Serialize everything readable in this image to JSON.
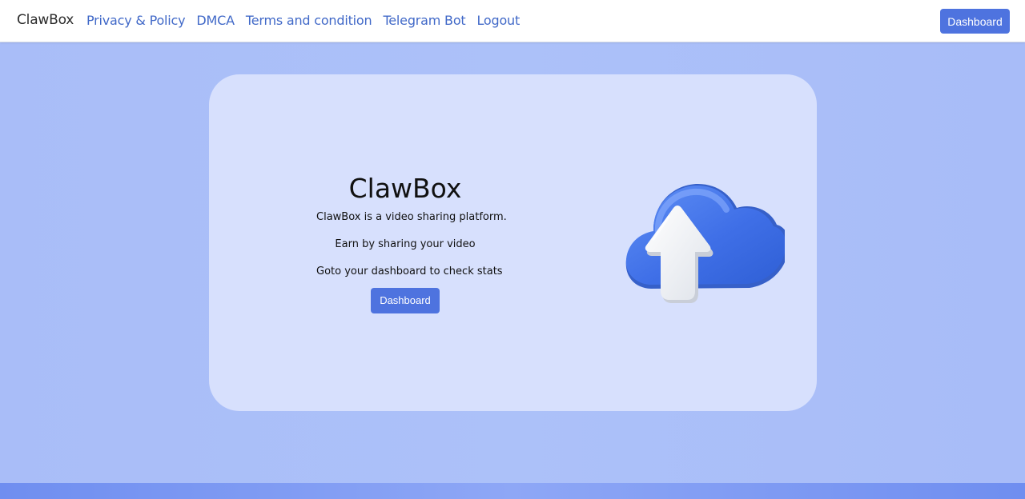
{
  "nav": {
    "brand": "ClawBox",
    "links": [
      "Privacy & Policy",
      "DMCA",
      "Terms and condition",
      "Telegram Bot",
      "Logout"
    ],
    "dashboard_button": "Dashboard"
  },
  "hero": {
    "title": "ClawBox",
    "line1": "ClawBox is a video sharing platform.",
    "line2": "Earn by sharing your video",
    "line3": "Goto your dashboard to check stats",
    "button": "Dashboard"
  },
  "icons": {
    "hero_image": "cloud-upload-icon"
  },
  "colors": {
    "primary": "#4e73df",
    "nav_link": "#4169c8",
    "background": "#a9bdf8",
    "card": "#d7e0fd",
    "footer": "#6f8ef0"
  }
}
